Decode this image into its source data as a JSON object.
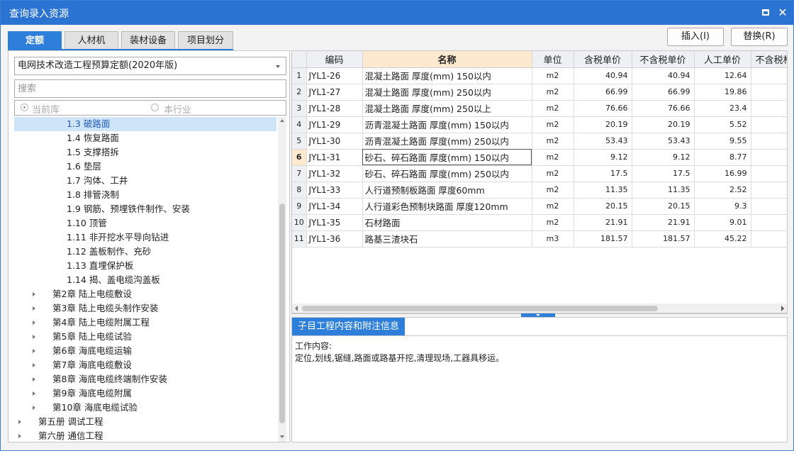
{
  "window": {
    "title": "查询录入资源"
  },
  "tabs": [
    {
      "label": "定额",
      "active": true
    },
    {
      "label": "人材机"
    },
    {
      "label": "装材设备"
    },
    {
      "label": "项目划分"
    }
  ],
  "toolbar": {
    "insert_label": "插入(I)",
    "replace_label": "替换(R)"
  },
  "left": {
    "dropdown_value": "电网技术改造工程预算定额(2020年版)",
    "search_placeholder": "搜索",
    "radio_current": "当前库",
    "radio_industry": "本行业"
  },
  "tree": [
    {
      "label": "1.3 破路面",
      "level": 3,
      "selected": true
    },
    {
      "label": "1.4 恢复路面",
      "level": 3
    },
    {
      "label": "1.5 支撑搭拆",
      "level": 3
    },
    {
      "label": "1.6 垫层",
      "level": 3
    },
    {
      "label": "1.7 沟体、工井",
      "level": 3
    },
    {
      "label": "1.8 排管浇制",
      "level": 3
    },
    {
      "label": "1.9 钢筋、预埋铁件制作、安装",
      "level": 3
    },
    {
      "label": "1.10 顶管",
      "level": 3
    },
    {
      "label": "1.11 非开挖水平导向钻进",
      "level": 3
    },
    {
      "label": "1.12 盖板制作、充砂",
      "level": 3
    },
    {
      "label": "1.13 直埋保护板",
      "level": 3
    },
    {
      "label": "1.14 揭、盖电缆沟盖板",
      "level": 3
    },
    {
      "label": "第2章 陆上电缆敷设",
      "level": 2
    },
    {
      "label": "第3章 陆上电缆头制作安装",
      "level": 2
    },
    {
      "label": "第4章 陆上电缆附属工程",
      "level": 2
    },
    {
      "label": "第5章 陆上电缆试验",
      "level": 2
    },
    {
      "label": "第6章 海底电缆运输",
      "level": 2
    },
    {
      "label": "第7章 海底电缆敷设",
      "level": 2
    },
    {
      "label": "第8章 海底电缆终端制作安装",
      "level": 2
    },
    {
      "label": "第9章 海底电缆附属",
      "level": 2
    },
    {
      "label": "第10章 海底电缆试验",
      "level": 2
    },
    {
      "label": "第五册 调试工程",
      "level": 1
    },
    {
      "label": "第六册 通信工程",
      "level": 1
    }
  ],
  "grid": {
    "columns": [
      "",
      "编码",
      "名称",
      "单位",
      "含税单价",
      "不含税单价",
      "人工单价",
      "不含税材"
    ],
    "rows": [
      {
        "n": "1",
        "code": "JYL1-26",
        "name": "混凝土路面 厚度(mm) 150以内",
        "unit": "m2",
        "tax": "40.94",
        "notax": "40.94",
        "labor": "12.64"
      },
      {
        "n": "2",
        "code": "JYL1-27",
        "name": "混凝土路面 厚度(mm) 250以内",
        "unit": "m2",
        "tax": "66.99",
        "notax": "66.99",
        "labor": "19.86"
      },
      {
        "n": "3",
        "code": "JYL1-28",
        "name": "混凝土路面 厚度(mm) 250以上",
        "unit": "m2",
        "tax": "76.66",
        "notax": "76.66",
        "labor": "23.4"
      },
      {
        "n": "4",
        "code": "JYL1-29",
        "name": "沥青混凝土路面 厚度(mm) 150以内",
        "unit": "m2",
        "tax": "20.19",
        "notax": "20.19",
        "labor": "5.52"
      },
      {
        "n": "5",
        "code": "JYL1-30",
        "name": "沥青混凝土路面 厚度(mm) 250以内",
        "unit": "m2",
        "tax": "53.43",
        "notax": "53.43",
        "labor": "9.55"
      },
      {
        "n": "6",
        "code": "JYL1-31",
        "name": "砂石、碎石路面 厚度(mm) 150以内",
        "unit": "m2",
        "tax": "9.12",
        "notax": "9.12",
        "labor": "8.77",
        "active": true
      },
      {
        "n": "7",
        "code": "JYL1-32",
        "name": "砂石、碎石路面 厚度(mm) 250以内",
        "unit": "m2",
        "tax": "17.5",
        "notax": "17.5",
        "labor": "16.99"
      },
      {
        "n": "8",
        "code": "JYL1-33",
        "name": "人行道预制板路面 厚度60mm",
        "unit": "m2",
        "tax": "11.35",
        "notax": "11.35",
        "labor": "2.52"
      },
      {
        "n": "9",
        "code": "JYL1-34",
        "name": "人行道彩色预制块路面 厚度120mm",
        "unit": "m2",
        "tax": "20.15",
        "notax": "20.15",
        "labor": "9.3"
      },
      {
        "n": "10",
        "code": "JYL1-35",
        "name": "石材路面",
        "unit": "m2",
        "tax": "21.91",
        "notax": "21.91",
        "labor": "9.01"
      },
      {
        "n": "11",
        "code": "JYL1-36",
        "name": "路基三渣块石",
        "unit": "m3",
        "tax": "181.57",
        "notax": "181.57",
        "labor": "45.22"
      }
    ]
  },
  "info": {
    "tab_label": "子目工程内容和附注信息",
    "heading": "工作内容:",
    "content": "定位,划线,锯缝,路面或路基开挖,清理现场,工器具移运。"
  },
  "colors": {
    "titlebar": "#2b73d2",
    "accent": "#2e7fd9",
    "selected_row": "#cfe3f9",
    "sorted_header": "#fde9cf"
  },
  "icons": [
    "maximize-icon",
    "close-icon",
    "dropdown-caret-icon",
    "tree-expand-arrow-icon",
    "scroll-arrow-icon"
  ]
}
